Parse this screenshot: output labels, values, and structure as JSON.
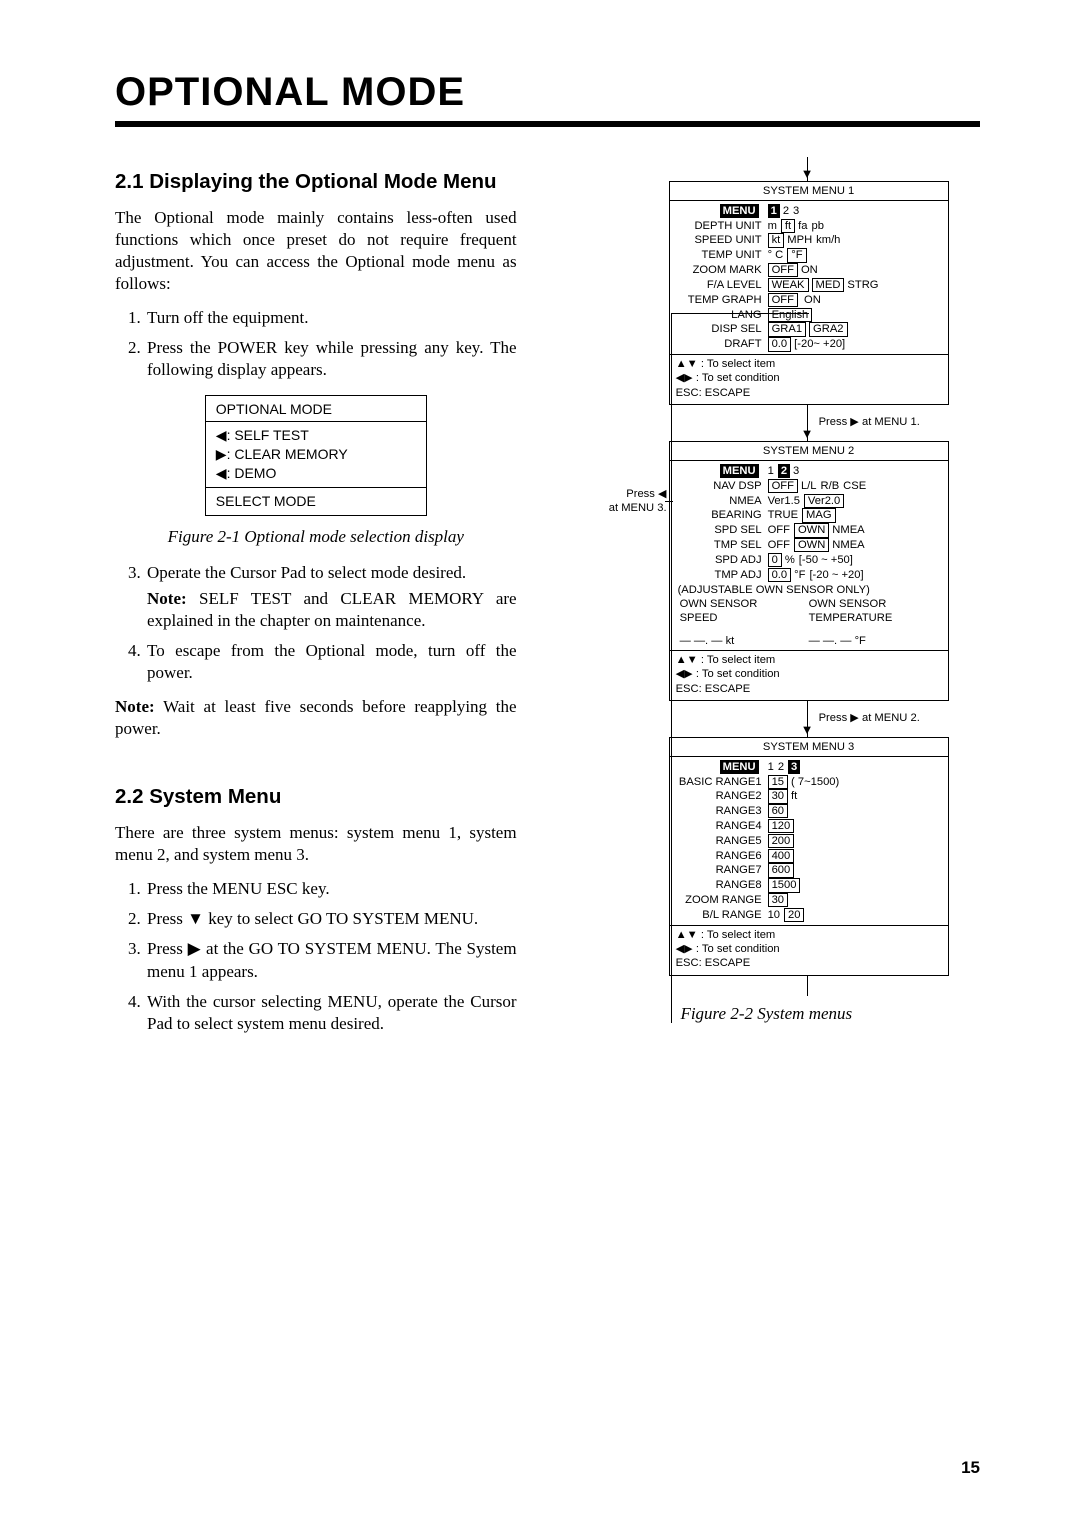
{
  "chapterTitle": "OPTIONAL MODE",
  "sec21": {
    "head": "2.1 Displaying the Optional Mode Menu",
    "intro": "The Optional mode mainly contains less-often used functions which once preset do not require frequent adjustment. You can access the Optional mode menu as follows:",
    "step1": "Turn off the equipment.",
    "step2": "Press the POWER key while pressing any key. The following display appears.",
    "step3": "Operate the Cursor Pad to select mode desired.",
    "step3noteLead": "Note:",
    "step3noteBody": " SELF TEST and CLEAR MEMORY are explained in the chapter on maintenance.",
    "step4": "To escape from the Optional mode, turn off the power.",
    "noteLead": "Note:",
    "noteBody": " Wait at least five seconds before reapplying the power.",
    "figCaption": "Figure 2-1 Optional mode selection display",
    "optBox": {
      "title": "OPTIONAL MODE",
      "l1l": "◀",
      "l1t": ": SELF TEST",
      "l2l": "▶",
      "l2t": ": CLEAR MEMORY",
      "l3l": "◀",
      "l3t": ": DEMO",
      "foot": "SELECT MODE"
    }
  },
  "sec22": {
    "head": "2.2 System Menu",
    "intro": "There are three system menus: system menu 1, system menu 2, and system menu 3.",
    "step1": "Press the MENU ESC key.",
    "step2a": "Press ",
    "step2arrow": "▼",
    "step2b": " key to select GO TO SYSTEM MENU.",
    "step3a": "Press ",
    "step3arrow": "▶",
    "step3b": " at  the GO TO SYSTEM MENU. The System menu 1 appears.",
    "step4": "With the cursor selecting MENU, operate the Cursor Pad to select system menu desired."
  },
  "conn12": "Press ▶  at MENU 1.",
  "conn23": "Press ▶  at MENU 2.",
  "sideNote": "Press ◀\nat MENU 3.",
  "fig22caption": "Figure 2-2 System menus",
  "foot": {
    "l1a": "▲▼",
    "l1b": " : To select item",
    "l2a": "◀▶",
    "l2b": " : To set condition",
    "l3": "ESC: ESCAPE"
  },
  "sm1": {
    "title": "SYSTEM MENU 1",
    "rows": [
      {
        "label": "MENU",
        "cells": [
          {
            "t": "1",
            "inv": true
          },
          {
            "t": "2"
          },
          {
            "t": "3"
          }
        ],
        "labelInv": true
      },
      {
        "label": "DEPTH UNIT",
        "cells": [
          {
            "t": "m"
          },
          {
            "t": "ft",
            "box": true
          },
          {
            "t": "fa"
          },
          {
            "t": "pb"
          }
        ]
      },
      {
        "label": "SPEED UNIT",
        "cells": [
          {
            "t": "kt",
            "box": true
          },
          {
            "t": "MPH"
          },
          {
            "t": "km/h"
          }
        ]
      },
      {
        "label": "TEMP UNIT",
        "cells": [
          {
            "t": "° C"
          },
          {
            "t": "°F",
            "box": true
          }
        ]
      },
      {
        "label": "ZOOM MARK",
        "cells": [
          {
            "t": "OFF",
            "box": true
          },
          {
            "t": "ON"
          }
        ]
      },
      {
        "label": "F/A LEVEL",
        "cells": [
          {
            "t": "WEAK",
            "box": true
          },
          {
            "t": "MED",
            "box": true
          },
          {
            "t": "STRG"
          }
        ]
      },
      {
        "label": "TEMP GRAPH",
        "cells": [
          {
            "t": "OFF",
            "box": true
          },
          {
            "t": " ON"
          }
        ]
      },
      {
        "label": "LANG",
        "cells": [
          {
            "t": "English",
            "box": true
          }
        ]
      },
      {
        "label": "DISP SEL",
        "cells": [
          {
            "t": "GRA1",
            "box": true
          },
          {
            "t": "GRA2",
            "box": true
          }
        ]
      },
      {
        "label": "DRAFT",
        "cells": [
          {
            "t": "0.0",
            "box": true
          },
          {
            "t": "[-20~ +20]"
          }
        ]
      }
    ]
  },
  "sm2": {
    "title": "SYSTEM MENU 2",
    "rows": [
      {
        "label": "MENU",
        "cells": [
          {
            "t": "1"
          },
          {
            "t": "2",
            "inv": true
          },
          {
            "t": "3"
          }
        ],
        "labelInv": true
      },
      {
        "label": "NAV DSP",
        "cells": [
          {
            "t": "OFF",
            "box": true
          },
          {
            "t": "L/L"
          },
          {
            "t": "R/B"
          },
          {
            "t": "CSE"
          }
        ]
      },
      {
        "label": "NMEA",
        "cells": [
          {
            "t": "Ver1.5"
          },
          {
            "t": "Ver2.0",
            "box": true
          }
        ]
      },
      {
        "label": "BEARING",
        "cells": [
          {
            "t": "TRUE"
          },
          {
            "t": "MAG",
            "box": true
          }
        ]
      },
      {
        "label": "SPD SEL",
        "cells": [
          {
            "t": "OFF"
          },
          {
            "t": "OWN",
            "box": true
          },
          {
            "t": "NMEA"
          }
        ]
      },
      {
        "label": "TMP SEL",
        "cells": [
          {
            "t": "OFF"
          },
          {
            "t": "OWN",
            "box": true
          },
          {
            "t": "NMEA"
          }
        ]
      },
      {
        "label": "SPD ADJ",
        "cells": [
          {
            "t": "0",
            "box": true
          },
          {
            "t": "%"
          },
          {
            "t": "[-50 ~ +50]"
          }
        ]
      },
      {
        "label": "TMP ADJ",
        "cells": [
          {
            "t": "0.0",
            "box": true
          },
          {
            "t": "°F"
          },
          {
            "t": "[-20 ~ +20]"
          }
        ]
      }
    ],
    "line_adj": "(ADJUSTABLE OWN SENSOR ONLY)",
    "ownL": "OWN SENSOR",
    "ownR": "OWN SENSOR",
    "spd": "SPEED",
    "tmp": "TEMPERATURE",
    "valL": "— —. — kt",
    "valR": "— —. — °F"
  },
  "sm3": {
    "title": "SYSTEM MENU 3",
    "rows": [
      {
        "label": "MENU",
        "cells": [
          {
            "t": "1"
          },
          {
            "t": "2"
          },
          {
            "t": "3",
            "inv": true
          }
        ],
        "labelInv": true
      },
      {
        "label": "BASIC RANGE1",
        "cells": [
          {
            "t": "15",
            "box": true
          },
          {
            "t": "( 7~1500)"
          }
        ]
      },
      {
        "label": "RANGE2",
        "cells": [
          {
            "t": "30",
            "box": true
          },
          {
            "t": "ft"
          }
        ]
      },
      {
        "label": "RANGE3",
        "cells": [
          {
            "t": "60",
            "box": true
          }
        ]
      },
      {
        "label": "RANGE4",
        "cells": [
          {
            "t": "120",
            "box": true
          }
        ]
      },
      {
        "label": "RANGE5",
        "cells": [
          {
            "t": "200",
            "box": true
          }
        ]
      },
      {
        "label": "RANGE6",
        "cells": [
          {
            "t": "400",
            "box": true
          }
        ]
      },
      {
        "label": "RANGE7",
        "cells": [
          {
            "t": "600",
            "box": true
          }
        ]
      },
      {
        "label": "RANGE8",
        "cells": [
          {
            "t": "1500",
            "box": true
          }
        ]
      },
      {
        "label": "ZOOM RANGE",
        "cells": [
          {
            "t": "30",
            "box": true
          }
        ]
      },
      {
        "label": "B/L RANGE",
        "cells": [
          {
            "t": "10"
          },
          {
            "t": "20",
            "box": true
          }
        ]
      }
    ]
  },
  "pageNumber": "15"
}
